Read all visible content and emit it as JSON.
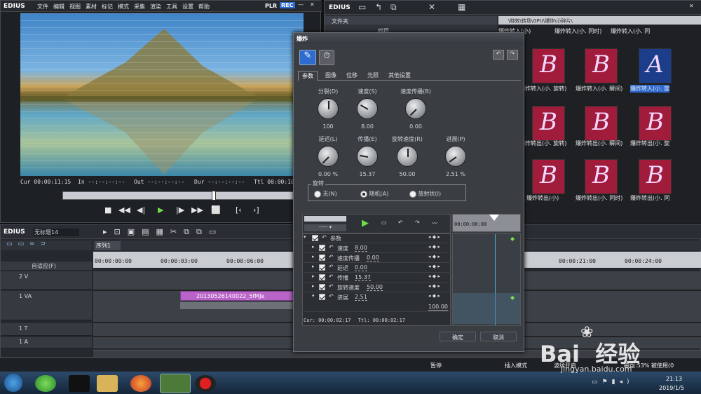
{
  "app": {
    "name": "EDIUS",
    "plr": "PLR",
    "rec": "REC"
  },
  "menu": [
    "文件",
    "编辑",
    "视图",
    "素材",
    "标记",
    "模式",
    "采集",
    "渲染",
    "工具",
    "设置",
    "帮助"
  ],
  "player": {
    "cur": "Cur 00:00:11:15",
    "in": "In --:--:--:--",
    "out": "Out --:--:--:--",
    "dur": "Dur --:--:--:--",
    "ttl": "Ttl 00:00:18:"
  },
  "bin": {
    "title": "EDIUS",
    "folder_header": "文件夹",
    "folder_item": "四页",
    "path": "\\特效\\转场\\GPU\\爆炸\\小碎片\\",
    "captions_top": [
      "爆炸转入(小)",
      "爆炸转入(小. 同时)",
      "爆炸转入(小. 同"
    ],
    "captions_row1": [
      "爆炸转入(小. 旋转)",
      "爆炸转入(小. 瞬间)",
      "爆炸转入(小. 旋"
    ],
    "captions_row2": [
      "爆炸转出(小. 旋转)",
      "爆炸转出(小. 瞬间)",
      "爆炸转出(小. 旋"
    ],
    "captions_row3": [
      "爆炸转出(小)",
      "爆炸转出(小. 同时)",
      "爆炸转出(小. 同"
    ],
    "letters": [
      "B",
      "B",
      "A",
      "B",
      "B",
      "B",
      "B",
      "B",
      "B"
    ]
  },
  "dialog": {
    "title": "爆炸",
    "tabs": [
      "参数",
      "图像",
      "位移",
      "光照",
      "其他设置"
    ],
    "knobs": [
      {
        "label": "分裂",
        "key": "(D)",
        "value": "100"
      },
      {
        "label": "速度",
        "key": "(S)",
        "value": "8.00"
      },
      {
        "label": "速度传播",
        "key": "(B)",
        "value": "0.00"
      },
      {
        "label": "延迟",
        "key": "(L)",
        "value": "0.00 %"
      },
      {
        "label": "传播",
        "key": "(E)",
        "value": "15.37"
      },
      {
        "label": "旋转速度",
        "key": "(R)",
        "value": "50.00"
      },
      {
        "label": "进展",
        "key": "(P)",
        "value": "2.51 %"
      }
    ],
    "rotation_label": "旋转",
    "rotation_options": [
      "无(N)",
      "随机(A)",
      "放射状(I)"
    ],
    "rotation_selected": 1,
    "tl_time": "00:00:00:00",
    "param_root": "参数",
    "params": [
      {
        "name": "速度",
        "value": "8.00"
      },
      {
        "name": "速度传播",
        "value": "0.00"
      },
      {
        "name": "延迟",
        "value": "0.00"
      },
      {
        "name": "传播",
        "value": "15.37"
      },
      {
        "name": "旋转速度",
        "value": "50.00"
      },
      {
        "name": "进展",
        "value": "2.51"
      }
    ],
    "progress_max": "100.00",
    "cur": "Cur: 00:00:02:17",
    "ttl": "Ttl: 00:00:02:17",
    "ok": "确定",
    "cancel": "取消"
  },
  "timeline": {
    "title": "EDIUS",
    "project": "无标题14",
    "sequence": "序列1",
    "fit": "自适应(F)",
    "tracks": [
      "2 V",
      "1 VA",
      "1 T",
      "1 A"
    ],
    "ruler": [
      "00:00:00:00",
      "00:00:03:00",
      "00:00:06:00",
      "00:00:21:00",
      "00:00:24:00"
    ],
    "clip": "20130526140022_5fMJe"
  },
  "status": {
    "pause": "暂停",
    "insert": "插入模式",
    "ripple": "波纹开启",
    "disk": "磁盘:53% 被使用(0"
  },
  "taskbar": {
    "time": "21:13",
    "date": "2019/1/5"
  },
  "watermark": {
    "text": "Bai  经验",
    "url": "jingyan.baidu.com"
  }
}
